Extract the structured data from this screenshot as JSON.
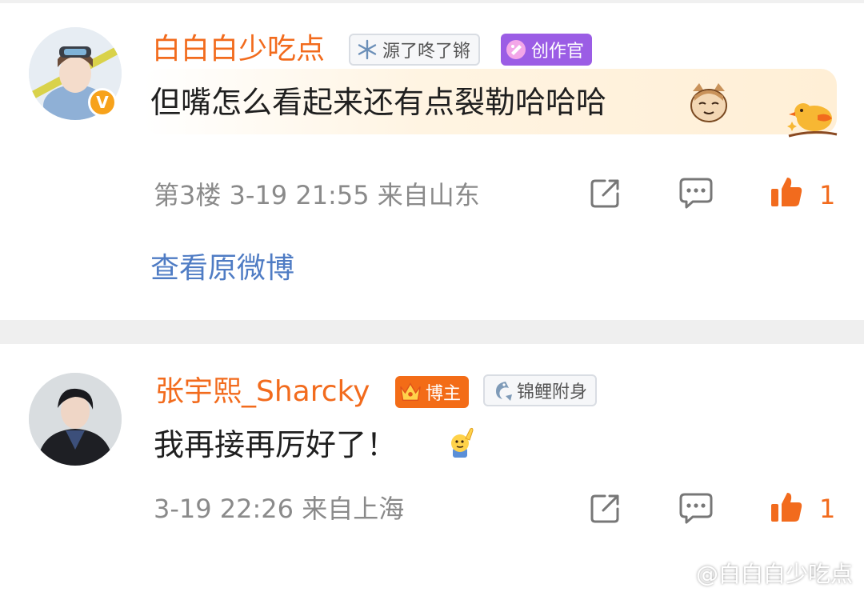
{
  "comments": [
    {
      "username": "白白白少吃点",
      "badges": {
        "badge1": "源了咚了锵",
        "badge2": "创作官"
      },
      "text": "但嘴怎么看起来还有点裂勒哈哈哈",
      "meta": "第3楼 3-19 21:55 来自山东",
      "likes": "1",
      "view_original": "查看原微博",
      "verified_mark": "V"
    },
    {
      "username": "张宇熙_Sharcky",
      "badges": {
        "badge1": "博主",
        "badge2": "锦鲤附身"
      },
      "text": "我再接再厉好了！",
      "meta": "3-19 22:26 来自上海",
      "likes": "1"
    }
  ],
  "watermark": "@白白白少吃点",
  "colors": {
    "username": "#f26b1d",
    "link": "#4f7cc4",
    "like": "#f26b1d",
    "meta": "#8a8a8a"
  },
  "icons": [
    "share-icon",
    "comment-icon",
    "like-icon",
    "snowflake-icon",
    "creator-icon",
    "crown-icon",
    "koi-icon",
    "cat-emoji-icon",
    "bird-decoration-icon",
    "raise-hand-emoji-icon",
    "weibo-logo-icon"
  ]
}
